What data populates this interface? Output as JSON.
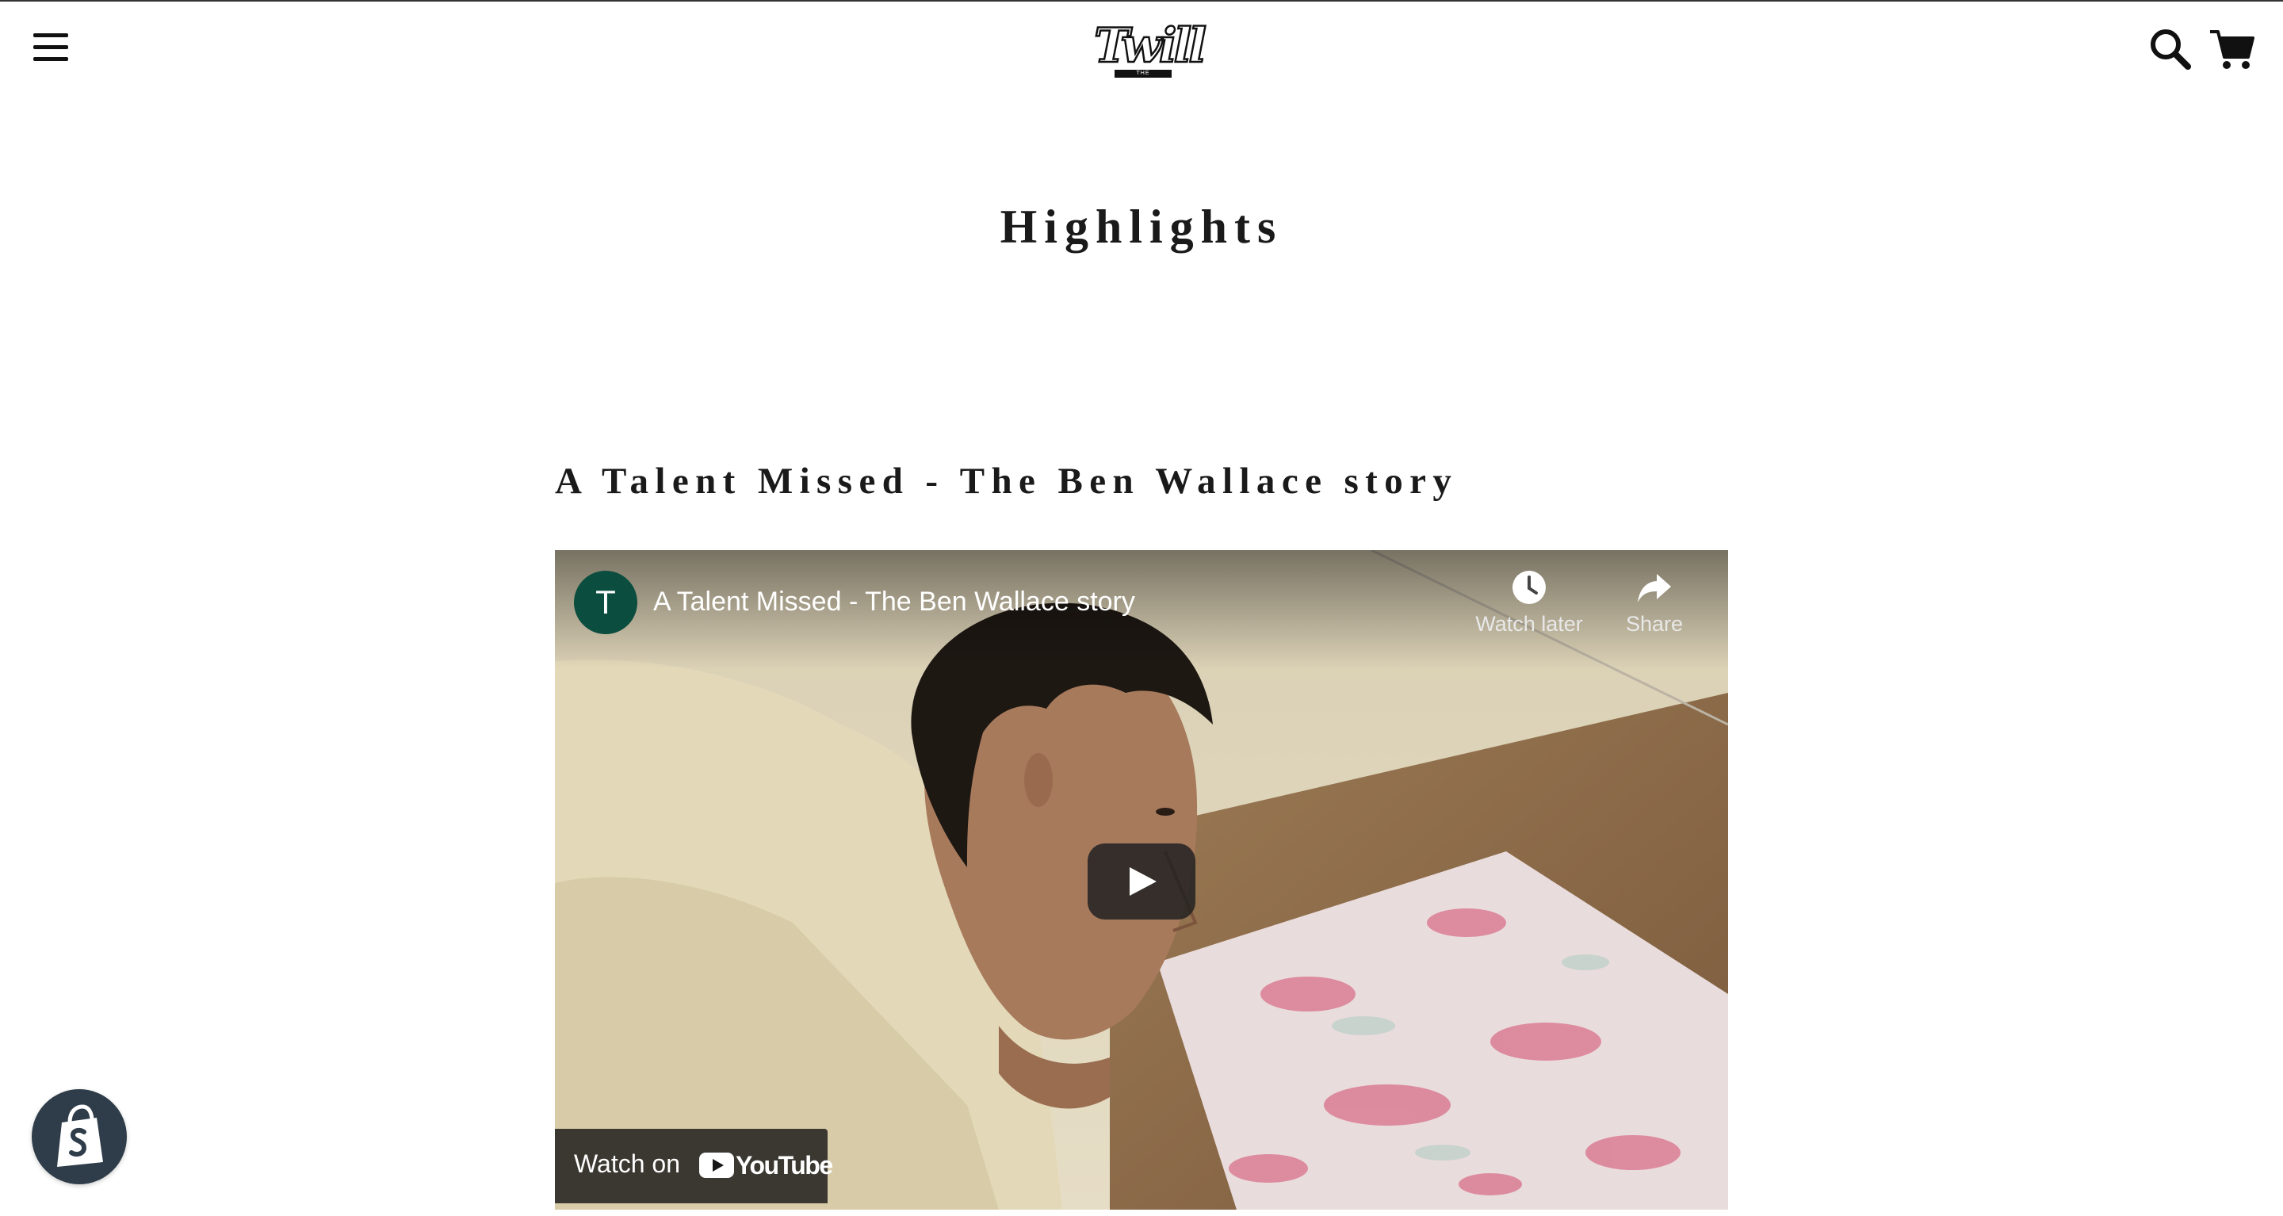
{
  "header": {
    "menu_icon": "hamburger-menu-icon",
    "logo_text": "Twill",
    "logo_subtext": "THE MESSENGER",
    "search_icon": "search-icon",
    "cart_icon": "cart-icon"
  },
  "page": {
    "title": "Highlights"
  },
  "video": {
    "heading": "A Talent Missed - The Ben Wallace story",
    "player": {
      "channel_initial": "T",
      "channel_avatar_color": "#0b4d3e",
      "title": "A Talent Missed - The Ben Wallace story",
      "watch_later_label": "Watch later",
      "share_label": "Share",
      "watch_on_label": "Watch on",
      "youtube_label": "YouTube",
      "play_icon": "play-icon"
    }
  },
  "floating": {
    "shopify_icon": "shopify-bag-icon",
    "badge_color": "#2f3d4a"
  }
}
